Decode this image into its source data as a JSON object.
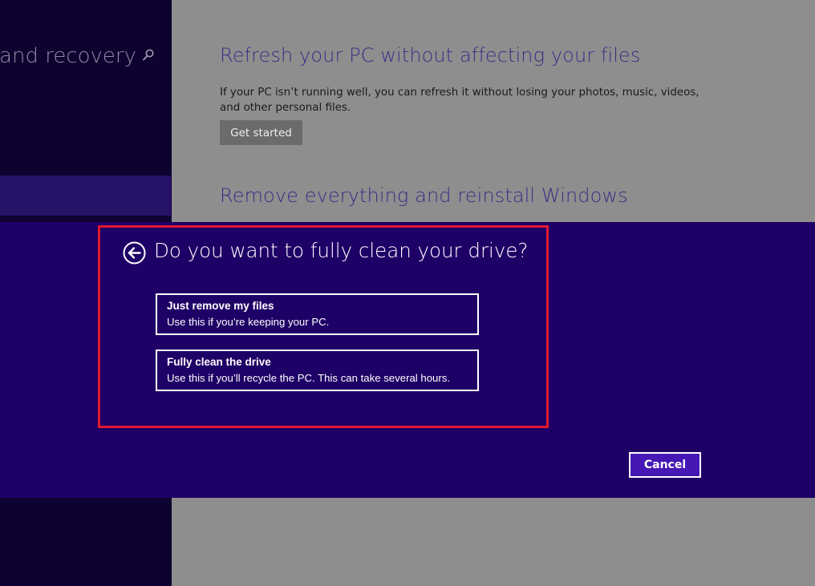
{
  "sidebar": {
    "title": "Update and recovery",
    "search_icon": "search-icon"
  },
  "refresh": {
    "heading": "Refresh your PC without affecting your files",
    "description": "If your PC isn’t running well, you can refresh it without losing your photos, music, videos, and other personal files.",
    "button": "Get started"
  },
  "remove": {
    "heading": "Remove everything and reinstall Windows"
  },
  "dialog": {
    "back_icon": "back-arrow-circle-icon",
    "title": "Do you want to fully clean your drive?",
    "options": [
      {
        "title": "Just remove my files",
        "description": "Use this if you’re keeping your PC."
      },
      {
        "title": "Fully clean the drive",
        "description": "Use this if you’ll recycle the PC. This can take several hours."
      }
    ],
    "cancel": "Cancel"
  },
  "colors": {
    "sidebar_bg": "#0e0230",
    "dialog_bg": "#1f0066",
    "accent_button": "#4617b4",
    "highlight": "#e1182f",
    "heading": "#3c2d85"
  }
}
